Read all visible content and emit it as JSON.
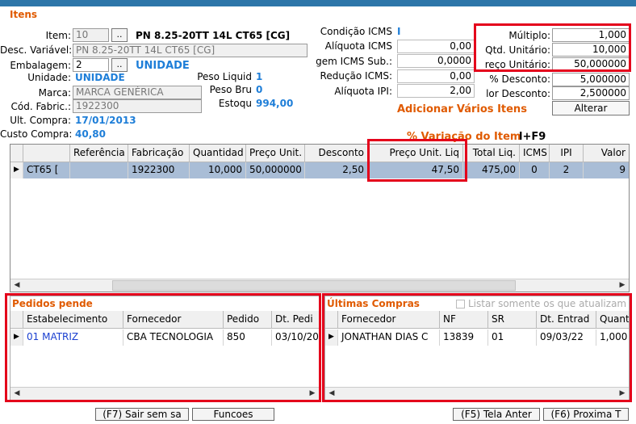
{
  "section_itens": "Itens",
  "item": {
    "label": "Item:",
    "code": "10",
    "lookup": "..",
    "description": "PN 8.25-20TT 14L CT65 [CG]"
  },
  "desc_variavel": {
    "label": "Desc. Variável:",
    "value": "PN 8.25-20TT 14L CT65 [CG]"
  },
  "embalagem": {
    "label": "Embalagem:",
    "value": "2",
    "lookup": "..",
    "unit": "UNIDADE"
  },
  "unidade": {
    "label": "Unidade:",
    "value": "UNIDADE"
  },
  "peso_liquido": {
    "label": "Peso Liquid",
    "value": "1"
  },
  "peso_bruto": {
    "label": "Peso Bru",
    "value": "0"
  },
  "estoque": {
    "label": "Estoqu",
    "value": "994,00"
  },
  "marca": {
    "label": "Marca:",
    "value": "MARCA GENÉRICA"
  },
  "cod_fabric": {
    "label": "Cód. Fabric.:",
    "value": "1922300"
  },
  "ult_compra": {
    "label": "Ult. Compra:",
    "value": "17/01/2013"
  },
  "custo_compra": {
    "label": "Custo Compra:",
    "value": "40,80"
  },
  "condicao_icms": {
    "label": "Condição ICMS",
    "value": "I"
  },
  "aliquota_icms": {
    "label": "Alíquota ICMS",
    "value": "0,00"
  },
  "margem_icms_sub": {
    "label": "gem ICMS Sub.:",
    "value": "0,0000"
  },
  "reducao_icms": {
    "label": "Redução ICMS:",
    "value": "0,00"
  },
  "aliquota_ipi": {
    "label": "Alíquota IPI:",
    "value": "2,00"
  },
  "multiplo": {
    "label": "Múltiplo:",
    "value": "1,000"
  },
  "qtd_unitario": {
    "label": "Qtd. Unitário:",
    "value": "10,000"
  },
  "preco_unitario": {
    "label": "reço Unitário:",
    "value": "50,000000"
  },
  "pct_desconto": {
    "label": "% Desconto:",
    "value": "5,000000"
  },
  "valor_desconto": {
    "label": "lor Desconto:",
    "value": "2,500000"
  },
  "adicionar_label": "Adicionar Vários Itens",
  "alterar_label": "Alterar",
  "variacao_label": "% Variação do Item",
  "shortcut_hint": "l+F9",
  "items_grid": {
    "columns": [
      "",
      "Referência",
      "Fabricação",
      "Quantidad",
      "Preço Unit.",
      "Desconto",
      "Preço Unit. Liq",
      "Total Liq.",
      "ICMS",
      "IPI",
      "Valor"
    ],
    "rows": [
      [
        "CT65 [",
        "",
        "1922300",
        "10,000",
        "50,000000",
        "2,50",
        "47,50",
        "475,00",
        "0",
        "2",
        "9"
      ]
    ]
  },
  "pedidos": {
    "title": "Pedidos pende",
    "columns": [
      "Estabelecimento",
      "Fornecedor",
      "Pedido",
      "Dt. Pedi"
    ],
    "rows": [
      [
        "01 MATRIZ",
        "CBA TECNOLOGIA",
        "850",
        "03/10/20"
      ]
    ]
  },
  "compras": {
    "title": "Últimas Compras",
    "checkbox_label": "Listar somente os que atualizam",
    "columns": [
      "Fornecedor",
      "NF",
      "SR",
      "Dt. Entrad",
      "Quant"
    ],
    "rows": [
      [
        "JONATHAN DIAS C",
        "13839",
        "01",
        "09/03/22",
        "1,000"
      ]
    ]
  },
  "footer": {
    "sair": "(F7) Sair sem sa",
    "funcoes": "Funcoes",
    "tela_anter": "(F5) Tela Anter",
    "proxima": "(F6) Proxima T"
  },
  "colors": {
    "accent": "#e05a00",
    "blue_value": "#1e7ed8",
    "highlight": "#e4001b",
    "selected_row": "#a9bdd6"
  }
}
